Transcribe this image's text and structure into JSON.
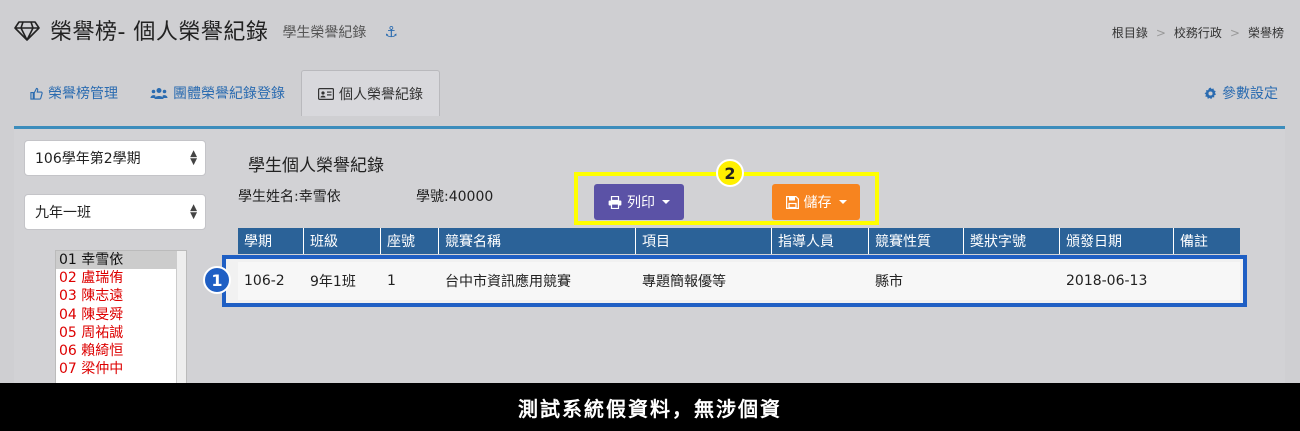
{
  "header": {
    "title": "榮譽榜- 個人榮譽紀錄",
    "subtitle": "學生榮譽紀錄",
    "breadcrumb": [
      "根目錄",
      "校務行政",
      "榮譽榜"
    ]
  },
  "tabs": [
    {
      "label": "榮譽榜管理",
      "icon": "thumbs-up-icon"
    },
    {
      "label": "團體榮譽紀錄登錄",
      "icon": "users-icon"
    },
    {
      "label": "個人榮譽紀錄",
      "icon": "id-card-icon",
      "active": true
    }
  ],
  "settings_label": "參數設定",
  "filters": {
    "semester": "106學年第2學期",
    "class": "九年一班"
  },
  "students": [
    {
      "label": "01 幸雪依",
      "selected": true
    },
    {
      "label": "02 盧瑞侑"
    },
    {
      "label": "03 陳志遠"
    },
    {
      "label": "04 陳旻舜"
    },
    {
      "label": "05 周祐誠"
    },
    {
      "label": "06 賴綺恒"
    },
    {
      "label": "07 梁仲中"
    }
  ],
  "record": {
    "title": "學生個人榮譽紀錄",
    "student_name": "學生姓名:幸雪依",
    "student_no": "學號:40000"
  },
  "buttons": {
    "print": "列印",
    "save": "儲存"
  },
  "badges": {
    "b1": "1",
    "b2": "2"
  },
  "table": {
    "headers": [
      "學期",
      "班級",
      "座號",
      "競賽名稱",
      "項目",
      "指導人員",
      "競賽性質",
      "獎狀字號",
      "頒發日期",
      "備註"
    ],
    "rows": [
      [
        "106-2",
        "9年1班",
        "1",
        "台中市資訊應用競賽",
        "專題簡報優等",
        "",
        "縣市",
        "",
        "2018-06-13",
        ""
      ]
    ]
  },
  "footer": "測試系統假資料，無涉個資",
  "colors": {
    "accent": "#2a6bb0",
    "table_header": "#2b6298",
    "print_button": "#5b52a6",
    "save_button": "#f7841f",
    "highlight_yellow": "#ffff00",
    "highlight_blue": "#1f5fc4"
  }
}
